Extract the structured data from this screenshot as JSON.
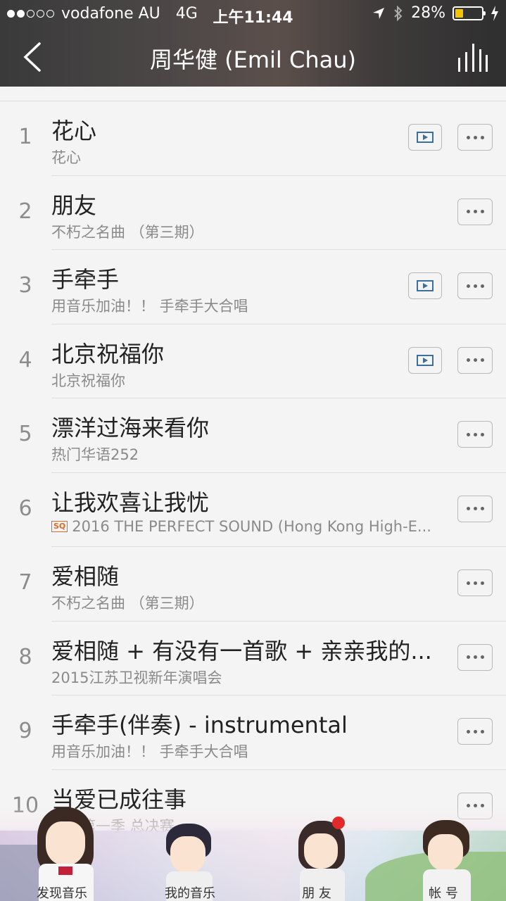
{
  "status_bar": {
    "carrier": "vodafone AU",
    "network": "4G",
    "time": "上午11:44",
    "battery": "28%",
    "signal_dots_filled": 2,
    "signal_dots_total": 5,
    "battery_fraction": 0.28
  },
  "nav": {
    "title": "周华健 (Emil Chau)",
    "back_icon": "chevron-left-icon",
    "playing_icon": "equalizer-icon"
  },
  "songs": [
    {
      "num": "1",
      "name": "花心",
      "sub": "花心",
      "mv": true,
      "sq": false
    },
    {
      "num": "2",
      "name": "朋友",
      "sub": "不朽之名曲 （第三期）",
      "mv": false,
      "sq": false
    },
    {
      "num": "3",
      "name": "手牵手",
      "sub": "用音乐加油！！ 手牵手大合唱",
      "mv": true,
      "sq": false
    },
    {
      "num": "4",
      "name": "北京祝福你",
      "sub": "北京祝福你",
      "mv": true,
      "sq": false
    },
    {
      "num": "5",
      "name": "漂洋过海来看你",
      "sub": "热门华语252",
      "mv": false,
      "sq": false
    },
    {
      "num": "6",
      "name": "让我欢喜让我忧",
      "sub": "2016 THE PERFECT SOUND (Hong Kong High-E...",
      "mv": false,
      "sq": true,
      "sq_label": "SQ"
    },
    {
      "num": "7",
      "name": "爱相随",
      "sub": "不朽之名曲 （第三期）",
      "mv": false,
      "sq": false
    },
    {
      "num": "8",
      "name": "爱相随 + 有没有一首歌 + 亲亲我的...",
      "sub": "2015江苏卫视新年演唱会",
      "mv": false,
      "sq": false
    },
    {
      "num": "9",
      "name": "手牵手(伴奏) - instrumental",
      "sub": "用音乐加油！！ 手牵手大合唱",
      "mv": false,
      "sq": false
    },
    {
      "num": "10",
      "name": "当爱已成往事",
      "sub": "歌手第一季 总决赛",
      "mv": false,
      "sq": false
    }
  ],
  "tabbar": {
    "tabs": [
      "发现音乐",
      "我的音乐",
      "朋 友",
      "帐 号"
    ]
  },
  "colors": {
    "accent_sq": "#e06a2b",
    "header_bg": "#3a3a3a",
    "battery_fill": "#f5c400"
  }
}
